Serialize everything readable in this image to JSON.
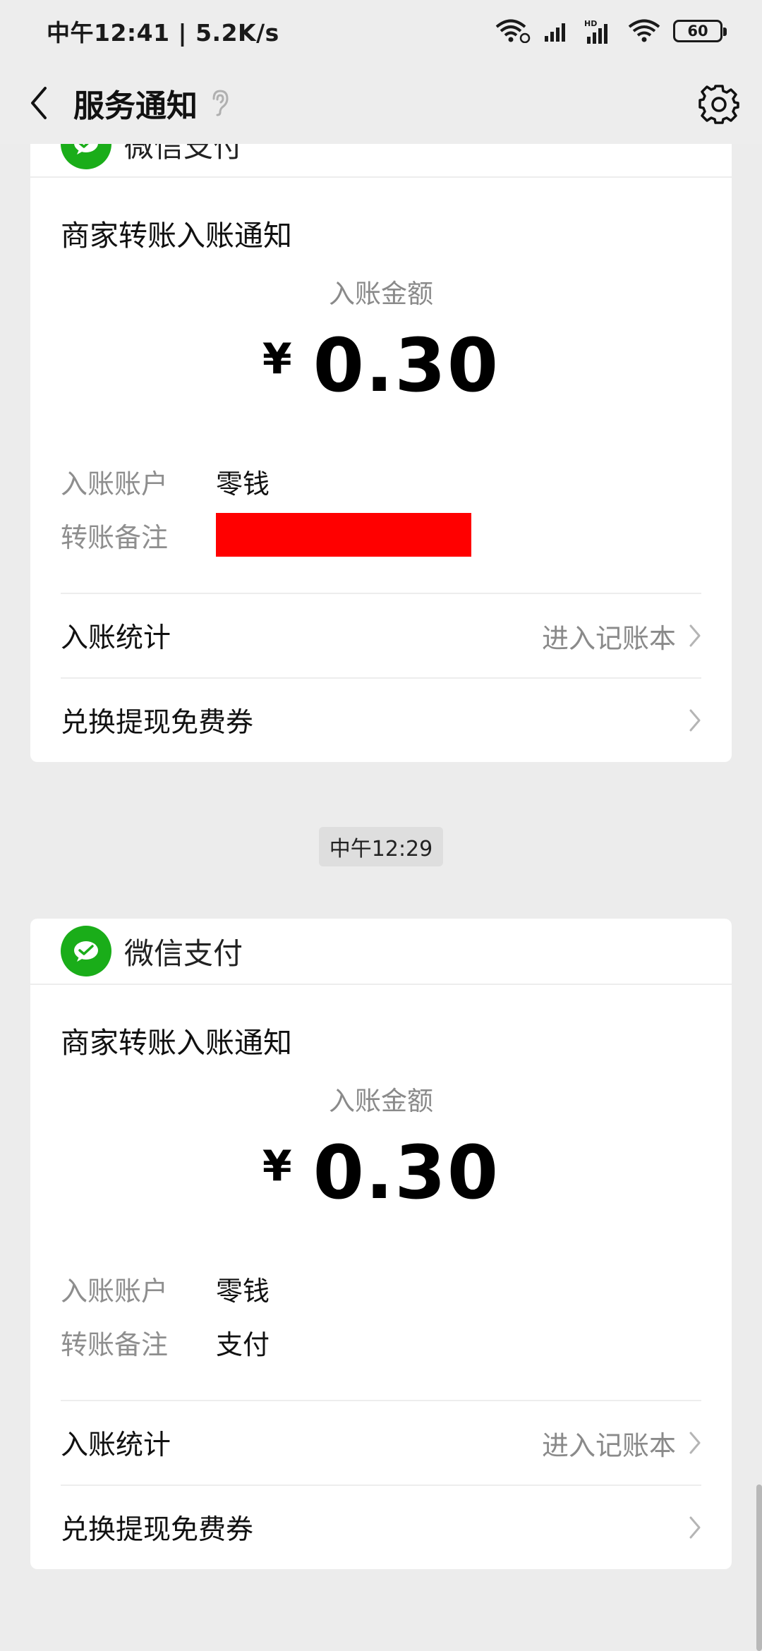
{
  "statusbar": {
    "time_speed": "中午12:41 | 5.2K/s",
    "battery": "60"
  },
  "navbar": {
    "title": "服务通知"
  },
  "cards": [
    {
      "brand": "微信支付",
      "title": "商家转账入账通知",
      "amount_label": "入账金额",
      "currency": "¥",
      "amount": "0.30",
      "account_key": "入账账户",
      "account_value": "零钱",
      "remark_key": "转账备注",
      "remark_value": "",
      "stats_label": "入账统计",
      "stats_hint": "进入记账本",
      "coupon_label": "兑换提现免费券"
    },
    {
      "brand": "微信支付",
      "title": "商家转账入账通知",
      "amount_label": "入账金额",
      "currency": "¥",
      "amount": "0.30",
      "account_key": "入账账户",
      "account_value": "零钱",
      "remark_key": "转账备注",
      "remark_value": "支付",
      "stats_label": "入账统计",
      "stats_hint": "进入记账本",
      "coupon_label": "兑换提现免费券"
    }
  ],
  "timestamp": "中午12:29",
  "colors": {
    "wechat_green": "#1aad19",
    "redaction": "#ff0000"
  }
}
